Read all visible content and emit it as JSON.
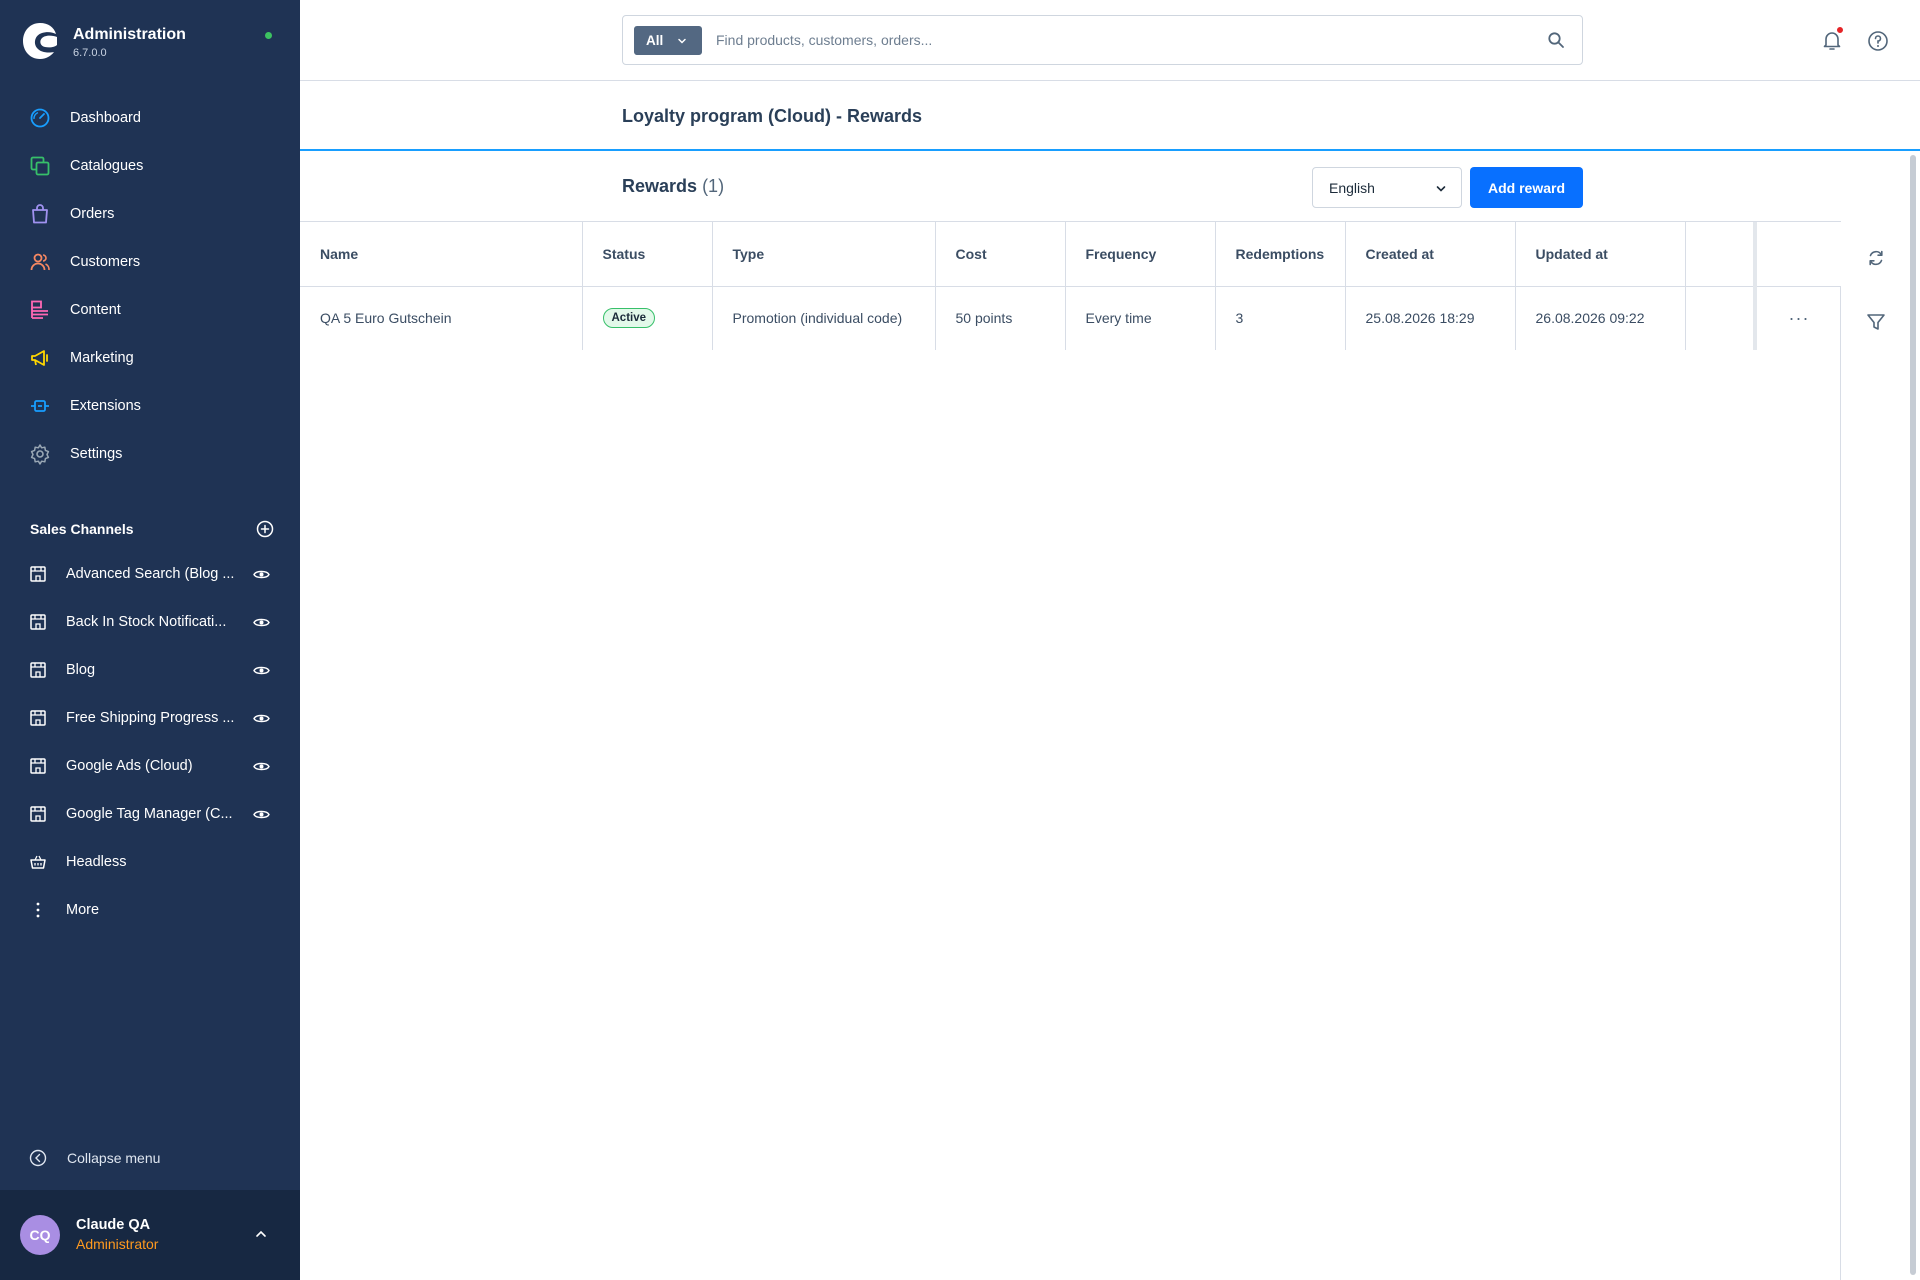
{
  "brand": {
    "title": "Administration",
    "version": "6.7.0.0"
  },
  "nav": [
    {
      "label": "Dashboard",
      "icon": "dashboard-icon",
      "color": "#189eff"
    },
    {
      "label": "Catalogues",
      "icon": "catalogue-icon",
      "color": "#37c06a"
    },
    {
      "label": "Orders",
      "icon": "orders-icon",
      "color": "#a092f0"
    },
    {
      "label": "Customers",
      "icon": "customers-icon",
      "color": "#f88962"
    },
    {
      "label": "Content",
      "icon": "content-icon",
      "color": "#ff68b4"
    },
    {
      "label": "Marketing",
      "icon": "marketing-icon",
      "color": "#ffd700"
    },
    {
      "label": "Extensions",
      "icon": "extensions-icon",
      "color": "#189eff"
    },
    {
      "label": "Settings",
      "icon": "settings-icon",
      "color": "#9aa8b5"
    }
  ],
  "sales_channels": {
    "title": "Sales Channels",
    "items": [
      {
        "label": "Advanced Search (Blog ...",
        "icon": "storefront-icon",
        "eye": true
      },
      {
        "label": "Back In Stock Notificati...",
        "icon": "storefront-icon",
        "eye": true
      },
      {
        "label": "Blog",
        "icon": "storefront-icon",
        "eye": true
      },
      {
        "label": "Free Shipping Progress ...",
        "icon": "storefront-icon",
        "eye": true
      },
      {
        "label": "Google Ads (Cloud)",
        "icon": "storefront-icon",
        "eye": true
      },
      {
        "label": "Google Tag Manager (C...",
        "icon": "storefront-icon",
        "eye": true
      },
      {
        "label": "Headless",
        "icon": "headless-icon",
        "eye": false
      },
      {
        "label": "More",
        "icon": "more-vertical-icon",
        "eye": false
      }
    ]
  },
  "collapse_label": "Collapse menu",
  "user": {
    "initials": "CQ",
    "name": "Claude QA",
    "role": "Administrator"
  },
  "search": {
    "scope": "All",
    "placeholder": "Find products, customers, orders..."
  },
  "page_title": "Loyalty program (Cloud) - Rewards",
  "toolbar": {
    "title": "Rewards",
    "count": "(1)",
    "language": "English",
    "add_label": "Add reward"
  },
  "table": {
    "columns": [
      "Name",
      "Status",
      "Type",
      "Cost",
      "Frequency",
      "Redemptions",
      "Created at",
      "Updated at"
    ],
    "rows": [
      {
        "name": "QA 5 Euro Gutschein",
        "status": "Active",
        "type": "Promotion (individual code)",
        "cost": "50 points",
        "frequency": "Every time",
        "redemptions": "3",
        "created_at": "25.08.2026 18:29",
        "updated_at": "26.08.2026 09:22"
      }
    ],
    "row_actions": "···"
  },
  "colors": {
    "sidebar": "#1f3354",
    "primary": "#0870ff",
    "accent": "#189eff",
    "active_badge": "#37c06a",
    "role": "#ff9a1f"
  }
}
